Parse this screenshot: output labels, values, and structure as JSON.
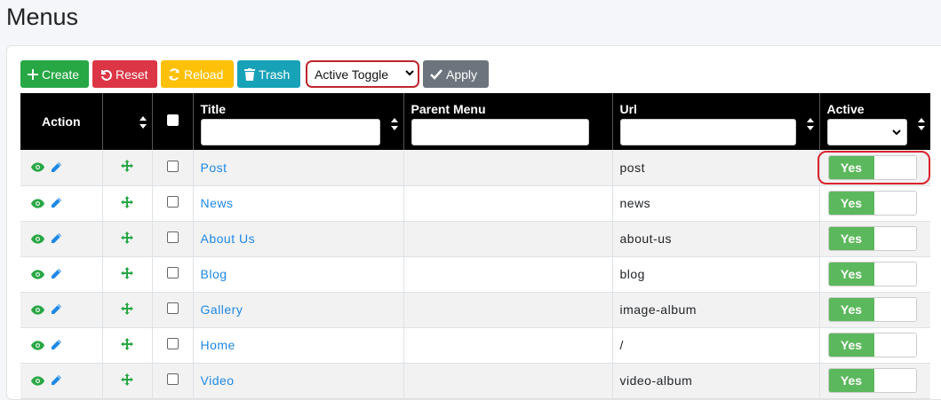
{
  "page": {
    "title": "Menus"
  },
  "toolbar": {
    "create_label": "Create",
    "reset_label": "Reset",
    "reload_label": "Reload",
    "trash_label": "Trash",
    "bulk_action_selected": "Active Toggle",
    "apply_label": "Apply"
  },
  "table": {
    "columns": {
      "action": "Action",
      "title": "Title",
      "parent_menu": "Parent Menu",
      "url": "Url",
      "active": "Active"
    },
    "rows": [
      {
        "title": "Post",
        "parent": "",
        "url": "post",
        "active": "Yes"
      },
      {
        "title": "News",
        "parent": "",
        "url": "news",
        "active": "Yes"
      },
      {
        "title": "About Us",
        "parent": "",
        "url": "about-us",
        "active": "Yes"
      },
      {
        "title": "Blog",
        "parent": "",
        "url": "blog",
        "active": "Yes"
      },
      {
        "title": "Gallery",
        "parent": "",
        "url": "image-album",
        "active": "Yes"
      },
      {
        "title": "Home",
        "parent": "",
        "url": "/",
        "active": "Yes"
      },
      {
        "title": "Video",
        "parent": "",
        "url": "video-album",
        "active": "Yes"
      }
    ]
  },
  "colors": {
    "create": "#28a745",
    "reset": "#dc3545",
    "reload": "#ffc107",
    "trash": "#17a2b8",
    "apply": "#6c757d",
    "link": "#1e88e5",
    "toggle_on": "#5cb85c"
  },
  "icons": [
    "plus-icon",
    "undo-icon",
    "sync-icon",
    "trash-icon",
    "check-icon",
    "eye-icon",
    "pencil-icon",
    "move-icon",
    "sort-icon",
    "chevron-down-icon"
  ]
}
